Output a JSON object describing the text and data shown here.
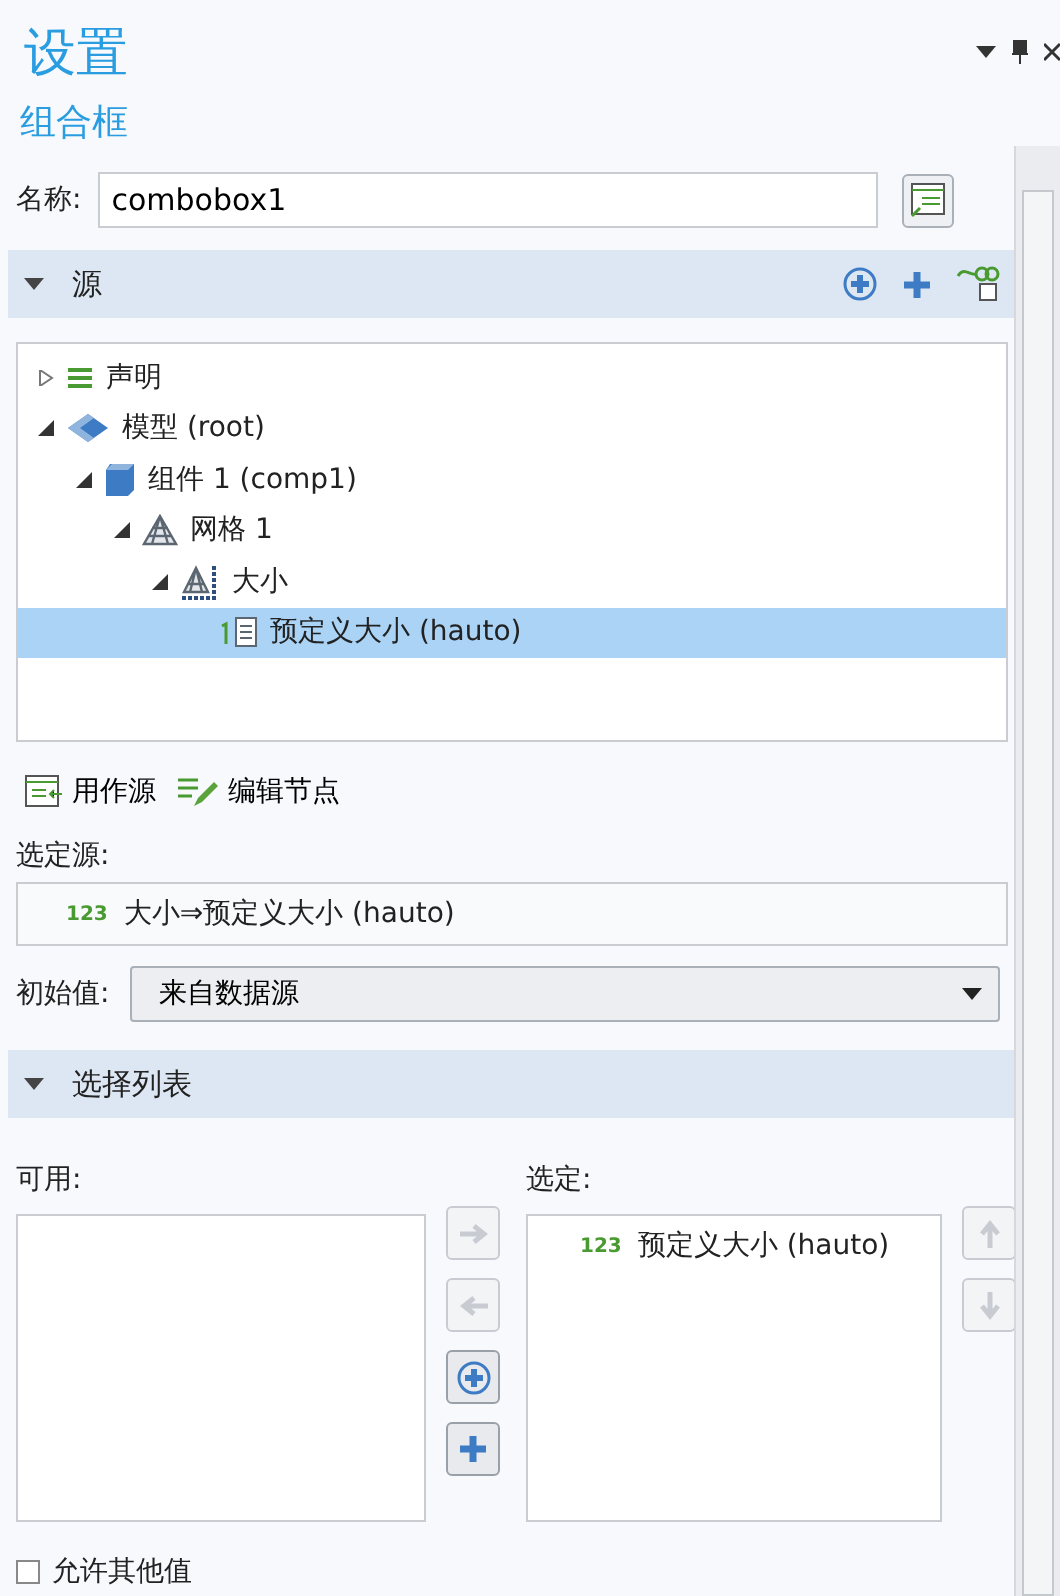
{
  "header": {
    "title": "设置",
    "subtitle": "组合框"
  },
  "name_field": {
    "label": "名称:",
    "value": "combobox1"
  },
  "source_section": {
    "title": "源",
    "expanded": true
  },
  "tree": [
    {
      "label": "声明",
      "kind": "declarations",
      "expanded": false,
      "selected": false
    },
    {
      "label": "模型 (root)",
      "kind": "model",
      "expanded": true,
      "selected": false,
      "children": [
        {
          "label": "组件 1 (comp1)",
          "kind": "component",
          "expanded": true,
          "selected": false,
          "children": [
            {
              "label": "网格 1",
              "kind": "mesh",
              "expanded": true,
              "selected": false,
              "children": [
                {
                  "label": "大小",
                  "kind": "size",
                  "expanded": true,
                  "selected": false,
                  "children": [
                    {
                      "label": "预定义大小 (hauto)",
                      "kind": "parameter",
                      "selected": true
                    }
                  ]
                }
              ]
            }
          ]
        }
      ]
    }
  ],
  "source_actions": [
    {
      "label": "用作源",
      "kind": "use"
    },
    {
      "label": "编辑节点",
      "kind": "edit"
    }
  ],
  "selected_source": {
    "label": "选定源:",
    "badge": "123",
    "value": "大小⇒预定义大小 (hauto)"
  },
  "initial_value": {
    "label": "初始值:",
    "value": "来自数据源"
  },
  "choice_section": {
    "title": "选择列表",
    "expanded": true
  },
  "available": {
    "label": "可用:"
  },
  "list_buttons": [
    {
      "kind": "right",
      "disabled": true
    },
    {
      "kind": "left",
      "disabled": true
    },
    {
      "kind": "add-circle",
      "disabled": false
    },
    {
      "kind": "add",
      "disabled": false
    }
  ],
  "chosen": {
    "label": "选定:",
    "items": [
      {
        "badge": "123",
        "label": "预定义大小 (hauto)"
      }
    ]
  },
  "order_buttons": [
    {
      "kind": "up",
      "disabled": true
    },
    {
      "kind": "down",
      "disabled": true
    }
  ],
  "allow_other": {
    "label": "允许其他值",
    "checked": false
  }
}
